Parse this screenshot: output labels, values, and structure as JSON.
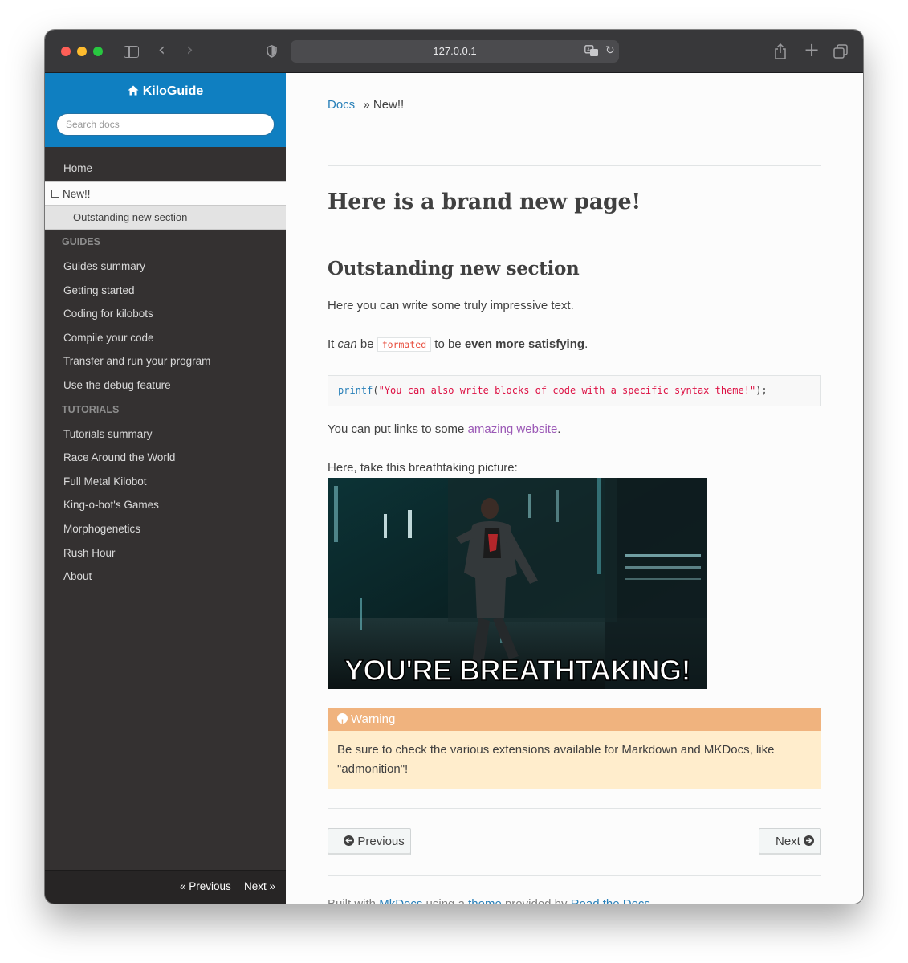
{
  "browser": {
    "url": "127.0.0.1"
  },
  "sidebar": {
    "brand": "KiloGuide",
    "search_placeholder": "Search docs",
    "home": "Home",
    "current": "New!!",
    "current_sub": "Outstanding new section",
    "guides_caption": "GUIDES",
    "guides": [
      "Guides summary",
      "Getting started",
      "Coding for kilobots",
      "Compile your code",
      "Transfer and run your program",
      "Use the debug feature"
    ],
    "tutorials_caption": "TUTORIALS",
    "tutorials": [
      "Tutorials summary",
      "Race Around the World",
      "Full Metal Kilobot",
      "King-o-bot's Games",
      "Morphogenetics",
      "Rush Hour",
      "About"
    ],
    "footer_prev": "« Previous",
    "footer_next": "Next »"
  },
  "content": {
    "breadcrumb_root": "Docs",
    "breadcrumb_sep": "»",
    "breadcrumb_current": "New!!",
    "title": "Here is a brand new page!",
    "section_title": "Outstanding new section",
    "p1": "Here you can write some truly impressive text.",
    "p2_a": "It ",
    "p2_em": "can",
    "p2_b": " be ",
    "p2_code": "formated",
    "p2_c": " to be ",
    "p2_strong": "even more satisfying",
    "p2_d": ".",
    "code_fn": "printf",
    "code_open": "(",
    "code_str": "\"You can also write blocks of code with a specific syntax theme!\"",
    "code_close": ");",
    "p3_a": "You can put links to some ",
    "p3_link": "amazing website",
    "p3_b": ".",
    "p4": "Here, take this breathtaking picture:",
    "picture_caption": "YOU'RE BREATHTAKING!",
    "warning_title": "Warning",
    "warning_body": "Be sure to check the various extensions available for Markdown and MKDocs, like \"admonition\"!",
    "prev_button": "Previous",
    "next_button": "Next",
    "footer_a": "Built with ",
    "footer_mkdocs": "MkDocs",
    "footer_b": " using a ",
    "footer_theme": "theme",
    "footer_c": " provided by ",
    "footer_rtd": "Read the Docs",
    "footer_d": "."
  },
  "colors": {
    "nav_bg": "#343131",
    "header_blue": "#0f7fc1",
    "link": "#2980b9",
    "link_visited": "#9b59b6",
    "warning_title_bg": "#f0b37e",
    "warning_body_bg": "#ffedcc"
  }
}
